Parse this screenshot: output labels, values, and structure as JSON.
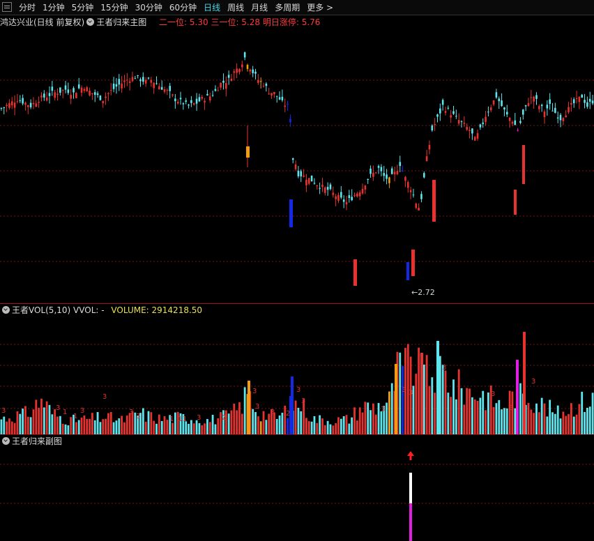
{
  "periods": [
    "分时",
    "1分钟",
    "5分钟",
    "15分钟",
    "30分钟",
    "60分钟",
    "日线",
    "周线",
    "月线",
    "多周期",
    "更多 >"
  ],
  "active_period": "日线",
  "main_panel": {
    "stock": "鸿达兴业(日线 前复权)",
    "indicator": "王者归来主图",
    "level2_label": "二一位: 5.30",
    "level3_label": "三一位: 5.28",
    "limit_label": "明日涨停: 5.76",
    "low_marker": "←2.72"
  },
  "vol_panel": {
    "indicator": "王者VOL(5,10)",
    "vvol_label": "VVOL: -",
    "volume_label": "VOLUME: 2914218.50"
  },
  "sub_panel": {
    "indicator": "王者归来副图"
  },
  "colors": {
    "up": "#e8322f",
    "down": "#5ee6ee",
    "blue": "#1428e8",
    "orange": "#f39c12",
    "magenta": "#e020e0",
    "grid": "#7a1515"
  },
  "chart_data": {
    "type": "candlestick",
    "price_points": [
      [
        0,
        4.42
      ],
      [
        3,
        4.47
      ],
      [
        6,
        4.52
      ],
      [
        9,
        4.48
      ],
      [
        11,
        4.45
      ],
      [
        14,
        4.52
      ],
      [
        17,
        4.55
      ],
      [
        19,
        4.58
      ],
      [
        22,
        4.6
      ],
      [
        24,
        4.62
      ],
      [
        27,
        4.58
      ],
      [
        29,
        4.63
      ],
      [
        31,
        4.65
      ],
      [
        33,
        4.6
      ],
      [
        36,
        4.55
      ],
      [
        38,
        4.52
      ],
      [
        40,
        4.58
      ],
      [
        43,
        4.65
      ],
      [
        47,
        4.72
      ],
      [
        50,
        4.75
      ],
      [
        54,
        4.7
      ],
      [
        56,
        4.72
      ],
      [
        58,
        4.68
      ],
      [
        61,
        4.62
      ],
      [
        63,
        4.58
      ],
      [
        65,
        4.52
      ],
      [
        68,
        4.48
      ],
      [
        70,
        4.45
      ],
      [
        73,
        4.48
      ],
      [
        75,
        4.52
      ],
      [
        78,
        4.55
      ],
      [
        80,
        4.6
      ],
      [
        82,
        4.68
      ],
      [
        85,
        4.72
      ],
      [
        87,
        4.8
      ],
      [
        89,
        4.86
      ],
      [
        91,
        4.95
      ],
      [
        92,
        4.9
      ],
      [
        94,
        4.8
      ],
      [
        96,
        4.72
      ],
      [
        98,
        4.68
      ],
      [
        100,
        4.6
      ],
      [
        102,
        4.58
      ],
      [
        104,
        4.52
      ],
      [
        105,
        4.48
      ],
      [
        107,
        4.45
      ],
      [
        108,
        4.3
      ],
      [
        109,
        3.9
      ],
      [
        110,
        3.85
      ],
      [
        111,
        3.75
      ],
      [
        113,
        3.72
      ],
      [
        116,
        3.68
      ],
      [
        119,
        3.62
      ],
      [
        122,
        3.58
      ],
      [
        125,
        3.52
      ],
      [
        127,
        3.48
      ],
      [
        129,
        3.45
      ],
      [
        131,
        3.5
      ],
      [
        133,
        3.55
      ],
      [
        135,
        3.6
      ],
      [
        137,
        3.7
      ],
      [
        139,
        3.75
      ],
      [
        141,
        3.8
      ],
      [
        143,
        3.72
      ],
      [
        145,
        3.68
      ],
      [
        147,
        3.75
      ],
      [
        149,
        3.85
      ],
      [
        151,
        3.7
      ],
      [
        153,
        3.6
      ],
      [
        155,
        3.45
      ],
      [
        156,
        3.4
      ],
      [
        157,
        3.5
      ],
      [
        159,
        3.9
      ],
      [
        161,
        4.2
      ],
      [
        163,
        4.32
      ],
      [
        165,
        4.45
      ],
      [
        167,
        4.4
      ],
      [
        169,
        4.35
      ],
      [
        171,
        4.3
      ],
      [
        173,
        4.25
      ],
      [
        175,
        4.2
      ],
      [
        177,
        4.1
      ],
      [
        179,
        4.2
      ],
      [
        181,
        4.35
      ],
      [
        183,
        4.45
      ],
      [
        185,
        4.55
      ],
      [
        187,
        4.45
      ],
      [
        189,
        4.35
      ],
      [
        191,
        4.3
      ],
      [
        193,
        4.2
      ],
      [
        195,
        4.35
      ],
      [
        197,
        4.5
      ],
      [
        199,
        4.55
      ],
      [
        201,
        4.45
      ],
      [
        203,
        4.4
      ],
      [
        205,
        4.45
      ],
      [
        207,
        4.38
      ],
      [
        209,
        4.32
      ],
      [
        211,
        4.38
      ],
      [
        213,
        4.45
      ],
      [
        215,
        4.5
      ],
      [
        217,
        4.55
      ],
      [
        219,
        4.45
      ],
      [
        221,
        4.5
      ]
    ],
    "low_value": 2.72,
    "limit_up": 5.76
  }
}
